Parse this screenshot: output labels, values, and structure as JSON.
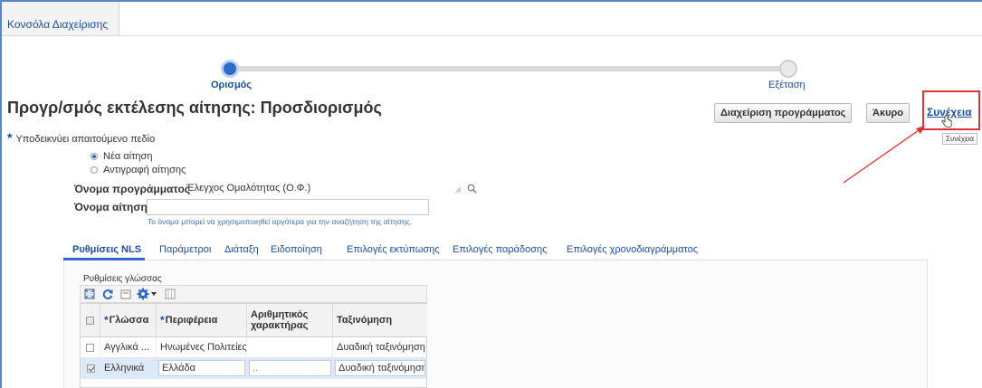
{
  "app": {
    "tab_label": "Κονσόλα Διαχείρισης"
  },
  "train": {
    "steps": [
      {
        "label": "Ορισμός",
        "active": true
      },
      {
        "label": "Εξέταση",
        "active": false
      }
    ]
  },
  "header": {
    "title": "Προγρ/σμός εκτέλεσης αίτησης: Προσδιορισμός",
    "manage_button": "Διαχείριση προγράμματος",
    "cancel_button": "Άκυρο",
    "next_link": "Συνέχεια",
    "next_tooltip": "Συνέχεια"
  },
  "required_note": {
    "marker": "*",
    "text": "Υποδεικνύει απαιτούμενο πεδίο"
  },
  "request_type": {
    "options": [
      {
        "label": "Νέα αίτηση",
        "selected": true
      },
      {
        "label": "Αντιγραφή αίτησης",
        "selected": false
      }
    ]
  },
  "program_name": {
    "label": "Όνομα προγράμματος",
    "value": "Έλεγχος Ομαλότητας (Ο.Φ.)"
  },
  "request_name": {
    "label": "Όνομα αίτησης",
    "value": "",
    "hint": "Το όνομα μπορεί να χρησιμοποιηθεί αργότερα για την αναζήτηση της αίτησης."
  },
  "subtabs": [
    {
      "label": "Ρυθμίσεις NLS",
      "active": true
    },
    {
      "label": "Παράμετροι",
      "active": false
    },
    {
      "label": "Διάταξη",
      "active": false
    },
    {
      "label": "Ειδοποίηση",
      "active": false
    },
    {
      "label": "Επιλογές εκτύπωσης",
      "active": false
    },
    {
      "label": "Επιλογές παράδοσης",
      "active": false
    },
    {
      "label": "Επιλογές χρονοδιαγράμματος",
      "active": false
    }
  ],
  "language_settings": {
    "section_label": "Ρυθμίσεις γλώσσας",
    "columns": {
      "language": "Γλώσσα",
      "territory": "Περιφέρεια",
      "numeric_line1": "Αριθμητικός",
      "numeric_line2": "χαρακτήρας",
      "sort": "Ταξινόμηση"
    },
    "rows": [
      {
        "checked": false,
        "language": "Αγγλικά ...",
        "territory": "Ηνωμένες Πολιτείες",
        "numeric": "",
        "sort": "Δυαδική ταξινόμηση"
      },
      {
        "checked": true,
        "language": "Ελληνικά",
        "territory": "Ελλάδα",
        "numeric": ",.",
        "sort": "Δυαδική ταξινόμηση"
      }
    ]
  },
  "colors": {
    "accent": "#1b4f9c",
    "highlight_box": "#e0333a",
    "selected_row": "#dce9f8"
  }
}
